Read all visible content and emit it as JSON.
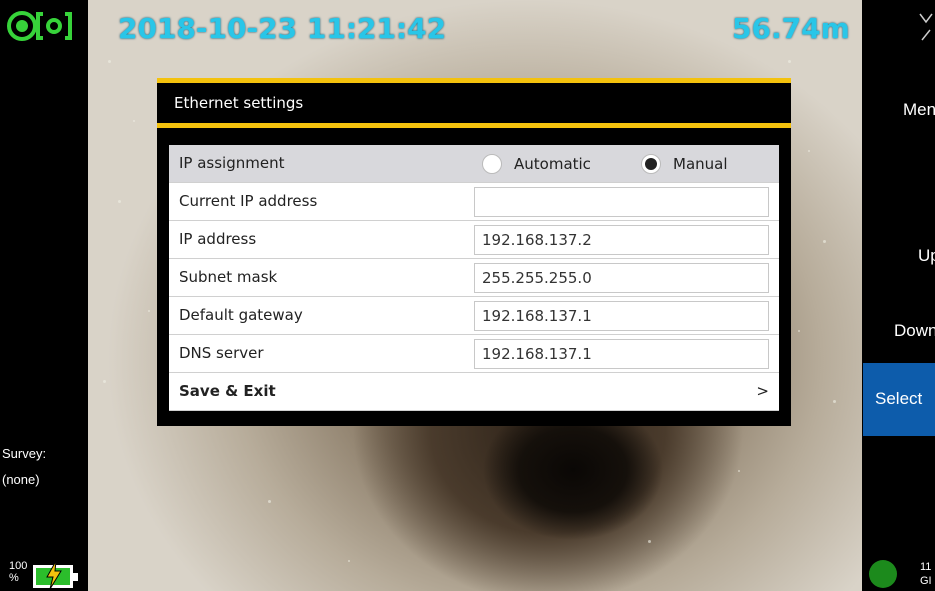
{
  "overlay": {
    "datetime": "2018-10-23 11:21:42",
    "distance": "56.74m"
  },
  "dialog": {
    "title": "Ethernet settings",
    "rows": [
      {
        "label": "IP assignment",
        "option_auto": "Automatic",
        "option_manual": "Manual",
        "selected": "Manual"
      },
      {
        "label": "Current IP address",
        "value": ""
      },
      {
        "label": "IP address",
        "value": "192.168.137.2"
      },
      {
        "label": "Subnet mask",
        "value": "255.255.255.0"
      },
      {
        "label": "Default gateway",
        "value": "192.168.137.1"
      },
      {
        "label": "DNS server",
        "value": "192.168.137.1"
      }
    ],
    "save_label": "Save & Exit",
    "save_chevron": ">"
  },
  "side_menu": {
    "menu": "Menu",
    "up": "Up",
    "down": "Down",
    "select": "Select"
  },
  "survey": {
    "label": "Survey:",
    "value": "(none)"
  },
  "battery": {
    "percent_value": "100",
    "percent_sign": "%"
  },
  "status": {
    "line1": "11",
    "line2": "GI"
  },
  "colors": {
    "overlay_text": "#29c6e8",
    "accent_yellow": "#f4c20d",
    "select_blue": "#0d5cab",
    "logo_green": "#37d33a"
  }
}
